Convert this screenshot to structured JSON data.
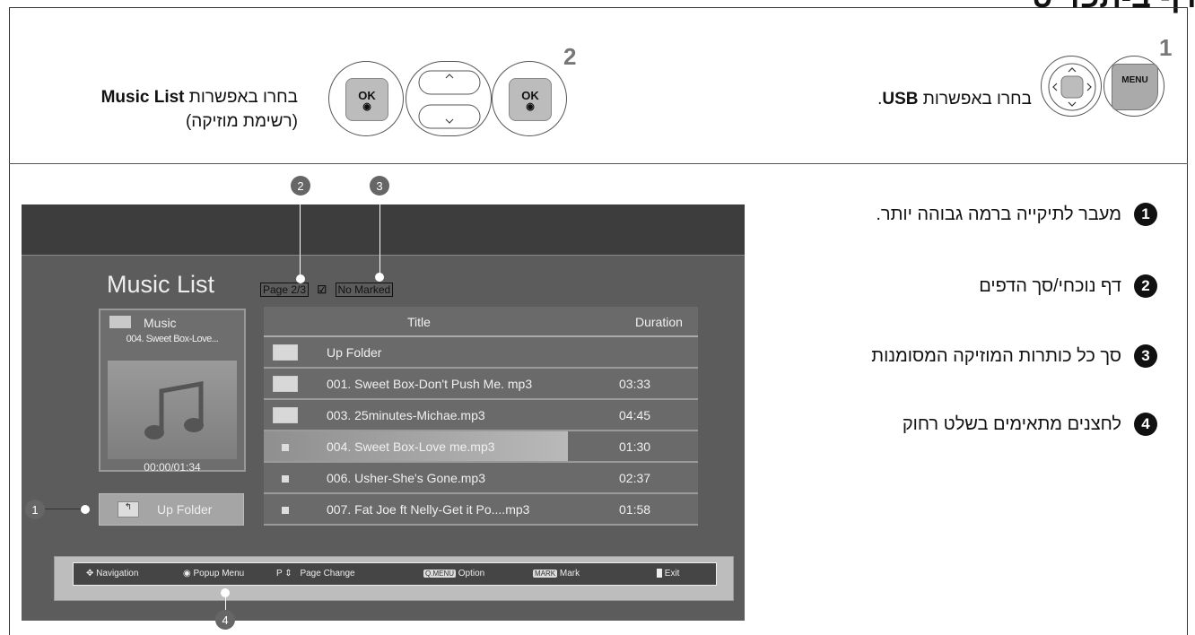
{
  "header": {
    "title": "דף ב-תפריט"
  },
  "step1": {
    "num": "1",
    "menu_label": "MENU",
    "text_prefix": "בחרו באפשרות",
    "text_bold": "USB",
    "text_suffix": "."
  },
  "step2": {
    "num": "2",
    "ok_label": "OK",
    "text_prefix": "בחרו באפשרות",
    "text_bold": "Music List",
    "text_line2": "(רשימת מוזיקה)"
  },
  "legend": [
    {
      "num": "1",
      "text": "מעבר לתיקייה ברמה גבוהה יותר."
    },
    {
      "num": "2",
      "text": "דף נוכחי/סך הדפים"
    },
    {
      "num": "3",
      "text": "סך כל כותרות המוזיקה המסומנות"
    },
    {
      "num": "4",
      "text": "לחצנים מתאימים בשלט רחוק"
    }
  ],
  "callouts": [
    "1",
    "2",
    "3",
    "4"
  ],
  "screen": {
    "title": "Music List",
    "page": "Page 2/3",
    "marked": "No Marked",
    "panel_folder": "Music",
    "panel_track": "004. Sweet Box-Love...",
    "panel_time": "00:00/01:34",
    "up_folder_btn": "Up Folder",
    "columns": {
      "title": "Title",
      "duration": "Duration"
    },
    "rows": [
      {
        "title": "Up Folder",
        "duration": "",
        "icon": "up-folder-icon"
      },
      {
        "title": "001. Sweet Box-Don't Push Me. mp3",
        "duration": "03:33",
        "icon": "folder-icon"
      },
      {
        "title": "003. 25minutes-Michae.mp3",
        "duration": "04:45",
        "icon": "folder-icon"
      },
      {
        "title": "004. Sweet Box-Love me.mp3",
        "duration": "01:30",
        "icon": "file-icon",
        "selected": true
      },
      {
        "title": "006. Usher-She's Gone.mp3",
        "duration": "02:37",
        "icon": "file-icon"
      },
      {
        "title": "007. Fat Joe ft Nelly-Get it Po....mp3",
        "duration": "01:58",
        "icon": "file-icon"
      }
    ],
    "nav": {
      "navigation": "Navigation",
      "popup": "Popup Menu",
      "page_p": "P",
      "page_change": "Page Change",
      "qmenu_tag": "Q.MENU",
      "option": "Option",
      "mark_tag": "MARK",
      "mark": "Mark",
      "exit": "Exit"
    }
  }
}
